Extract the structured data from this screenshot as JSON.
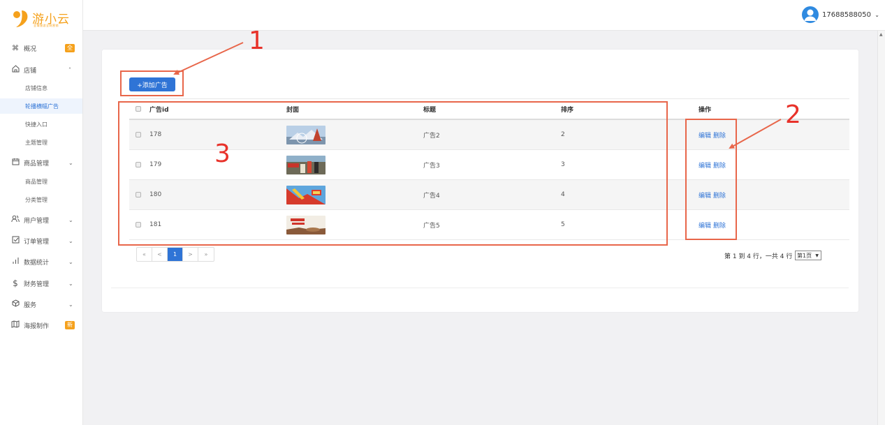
{
  "logo": {
    "name": "游小云",
    "tagline": "全域旅游全网营销"
  },
  "header": {
    "phone": "17688588050",
    "caret": "⌄"
  },
  "sidebar": {
    "items": [
      {
        "icon": "command-icon",
        "label": "概况",
        "badge": "全"
      },
      {
        "icon": "home-icon",
        "label": "店铺",
        "chevron": "˄"
      },
      {
        "icon": "calendar-icon",
        "label": "商品管理",
        "chevron": "⌄"
      },
      {
        "icon": "users-icon",
        "label": "用户管理",
        "chevron": "⌄"
      },
      {
        "icon": "checkbox-icon",
        "label": "订单管理",
        "chevron": "⌄"
      },
      {
        "icon": "bar-chart-icon",
        "label": "数据统计",
        "chevron": "⌄"
      },
      {
        "icon": "dollar-icon",
        "label": "财务管理",
        "chevron": "⌄"
      },
      {
        "icon": "cube-icon",
        "label": "服务",
        "chevron": "⌄"
      },
      {
        "icon": "map-icon",
        "label": "海报制作",
        "badge": "新"
      }
    ],
    "store_sub": [
      "店铺信息",
      "轮播横幅广告",
      "快捷入口",
      "主题管理"
    ],
    "goods_sub": [
      "商品管理",
      "分类管理"
    ]
  },
  "toolbar": {
    "add_label": "+添加广告"
  },
  "table": {
    "headers": [
      "广告id",
      "封面",
      "标题",
      "排序",
      "操作"
    ],
    "rows": [
      {
        "id": "178",
        "title": "广告2",
        "sort": "2",
        "edit": "编辑",
        "delete": "删除"
      },
      {
        "id": "179",
        "title": "广告3",
        "sort": "3",
        "edit": "编辑",
        "delete": "删除"
      },
      {
        "id": "180",
        "title": "广告4",
        "sort": "4",
        "edit": "编辑",
        "delete": "删除"
      },
      {
        "id": "181",
        "title": "广告5",
        "sort": "5",
        "edit": "编辑",
        "delete": "删除"
      }
    ]
  },
  "pagination": {
    "first": "«",
    "prev": "<",
    "current": "1",
    "next": ">",
    "last": "»",
    "info": "第 1 到 4 行，一共 4 行",
    "select": "第1页"
  },
  "annotations": [
    "1",
    "2",
    "3"
  ],
  "colors": {
    "accent": "#2f74d6",
    "brand": "#f5a11c",
    "annotation": "#e8322a"
  }
}
